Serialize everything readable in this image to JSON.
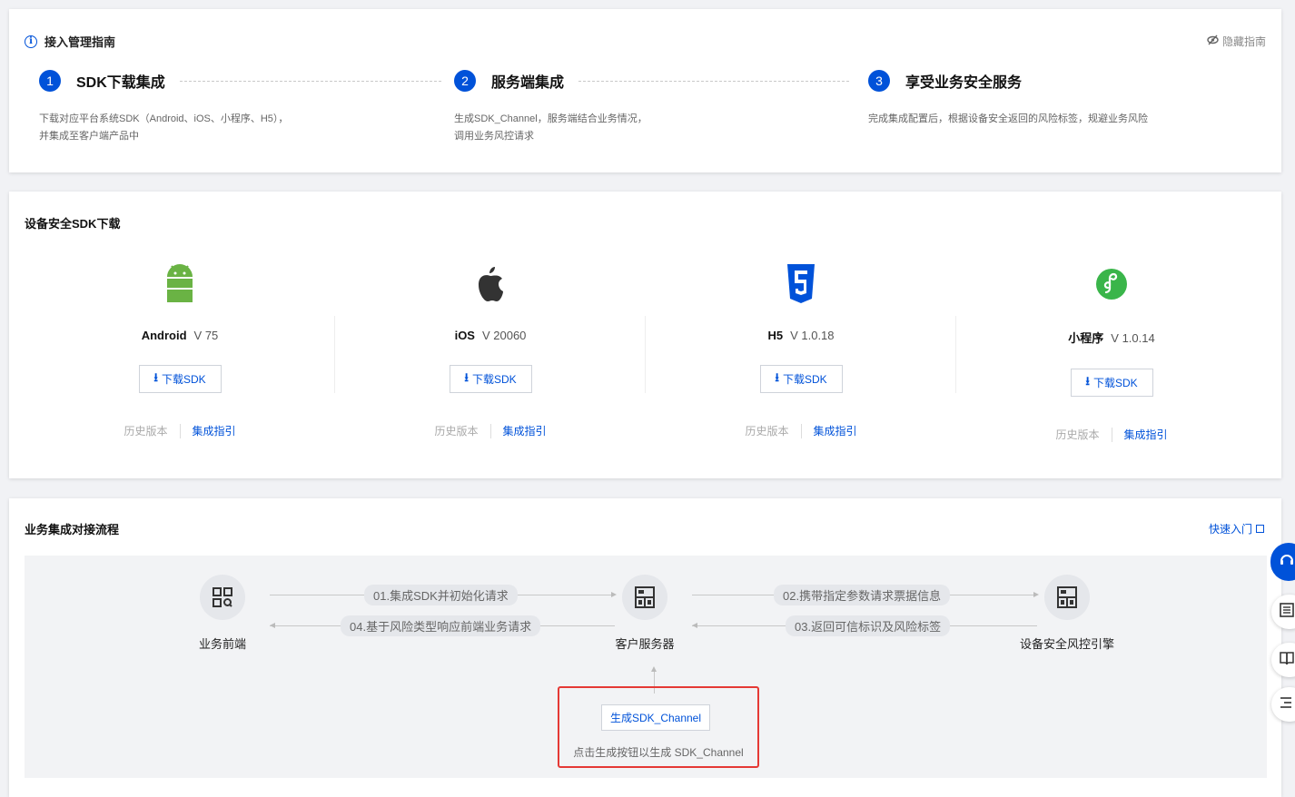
{
  "guide": {
    "title": "接入管理指南",
    "hide_label": "隐藏指南",
    "steps": [
      {
        "num": "1",
        "title": "SDK下载集成",
        "desc": "下载对应平台系统SDK（Android、iOS、小程序、H5），\n并集成至客户端产品中"
      },
      {
        "num": "2",
        "title": "服务端集成",
        "desc": "生成SDK_Channel，服务端结合业务情况，\n调用业务风控请求"
      },
      {
        "num": "3",
        "title": "享受业务安全服务",
        "desc": "完成集成配置后，根据设备安全返回的风险标签，规避业务风险"
      }
    ]
  },
  "sdk": {
    "title": "设备安全SDK下载",
    "download_label": "下载SDK",
    "history_label": "历史版本",
    "guide_label": "集成指引",
    "items": [
      {
        "name": "Android",
        "version": "V 75",
        "icon": "android-icon",
        "color": "#6ab344"
      },
      {
        "name": "iOS",
        "version": "V 20060",
        "icon": "apple-icon",
        "color": "#333333"
      },
      {
        "name": "H5",
        "version": "V 1.0.18",
        "icon": "html5-icon",
        "color": "#0052d9"
      },
      {
        "name": "小程序",
        "version": "V 1.0.14",
        "icon": "miniprogram-icon",
        "color": "#3ab54a"
      }
    ]
  },
  "flow": {
    "title": "业务集成对接流程",
    "quick_label": "快速入门",
    "nodes": {
      "frontend": "业务前端",
      "server": "客户服务器",
      "engine": "设备安全风控引擎"
    },
    "steps": {
      "s01": "01.集成SDK并初始化请求",
      "s02": "02.携带指定参数请求票据信息",
      "s03": "03.返回可信标识及风险标签",
      "s04": "04.基于风险类型响应前端业务请求"
    },
    "generate_button": "生成SDK_Channel",
    "generate_hint": "点击生成按钮以生成 SDK_Channel"
  },
  "colors": {
    "primary": "#0052d9",
    "highlight": "#e53935"
  }
}
